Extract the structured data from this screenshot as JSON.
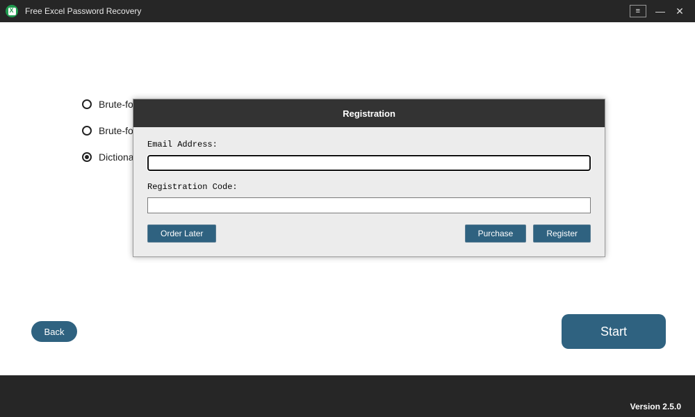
{
  "app": {
    "title": "Free Excel Password Recovery",
    "version": "Version 2.5.0"
  },
  "radios": {
    "opt1": "Brute-fo",
    "opt2": "Brute-fo",
    "opt3": "Dictiona"
  },
  "buttons": {
    "back": "Back",
    "start": "Start"
  },
  "modal": {
    "title": "Registration",
    "email_label": "Email Address:",
    "email_value": "",
    "code_label": "Registration Code:",
    "code_value": "",
    "order_later": "Order Later",
    "purchase": "Purchase",
    "register": "Register"
  },
  "window_controls": {
    "menu": "≡",
    "minimize": "—",
    "close": "✕"
  }
}
